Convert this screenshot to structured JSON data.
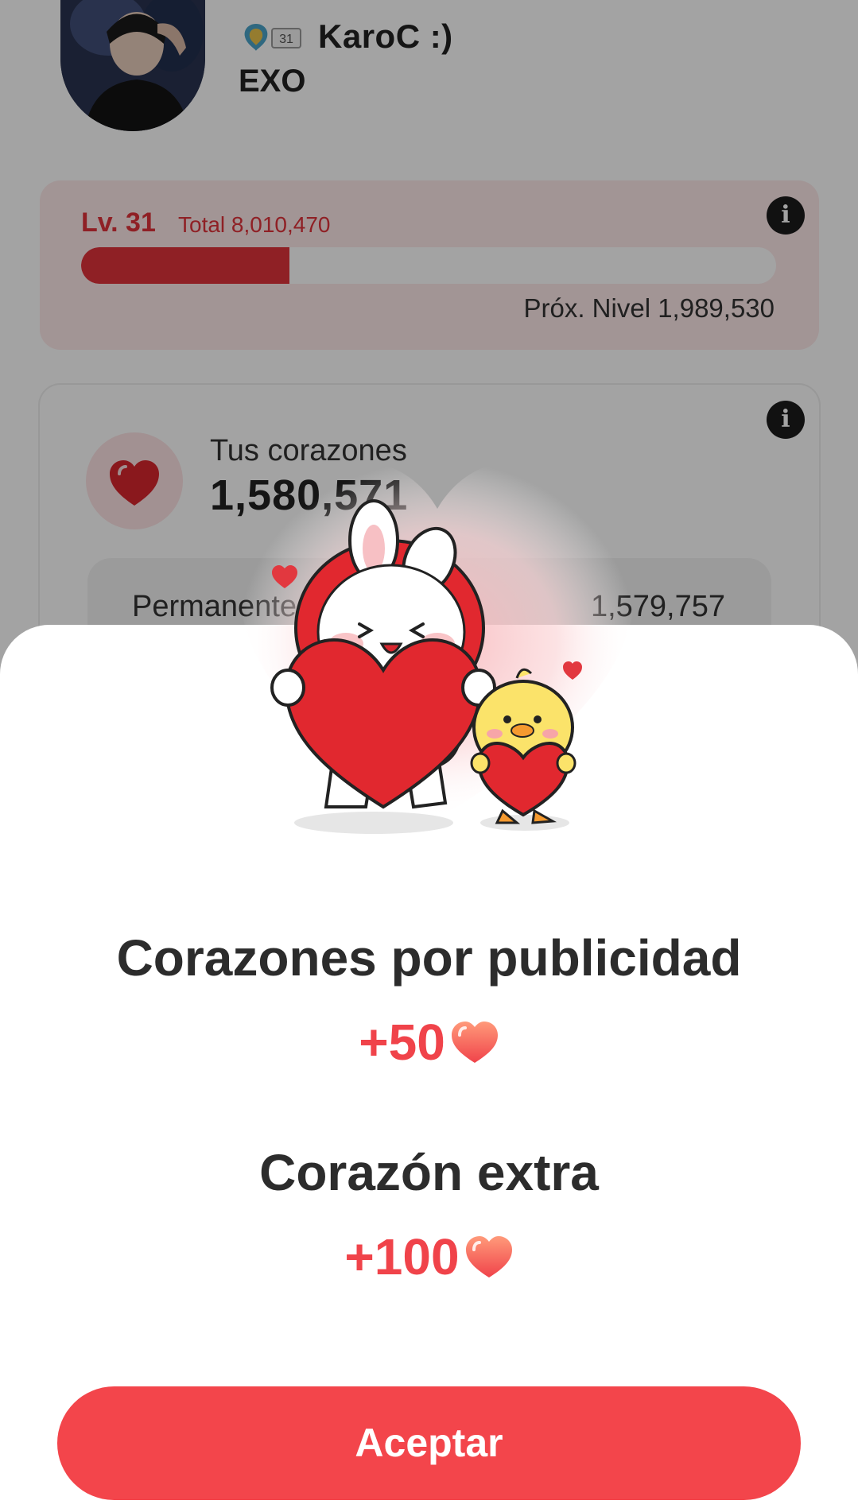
{
  "profile": {
    "username": "KaroC  :)",
    "group": "EXO",
    "badge_level": "31"
  },
  "level_card": {
    "level_label": "Lv. 31",
    "total_label": "Total 8,010,470",
    "progress_fraction": 0.3,
    "next_level_label": "Próx. Nivel 1,989,530"
  },
  "hearts_card": {
    "label": "Tus corazones",
    "value": "1,580,571",
    "permanent_label": "Permanentes",
    "permanent_value": "1,579,757"
  },
  "icons": {
    "info": "info-icon",
    "heart": "heart-icon"
  },
  "colors": {
    "accent": "#f3454b",
    "level_red": "#e0323a",
    "overlay": "rgba(0,0,0,0.36)"
  },
  "modal": {
    "ad_hearts_title": "Corazones por publicidad",
    "ad_hearts_amount": "+50",
    "extra_heart_title": "Corazón extra",
    "extra_heart_amount": "+100",
    "accept_label": "Aceptar"
  }
}
